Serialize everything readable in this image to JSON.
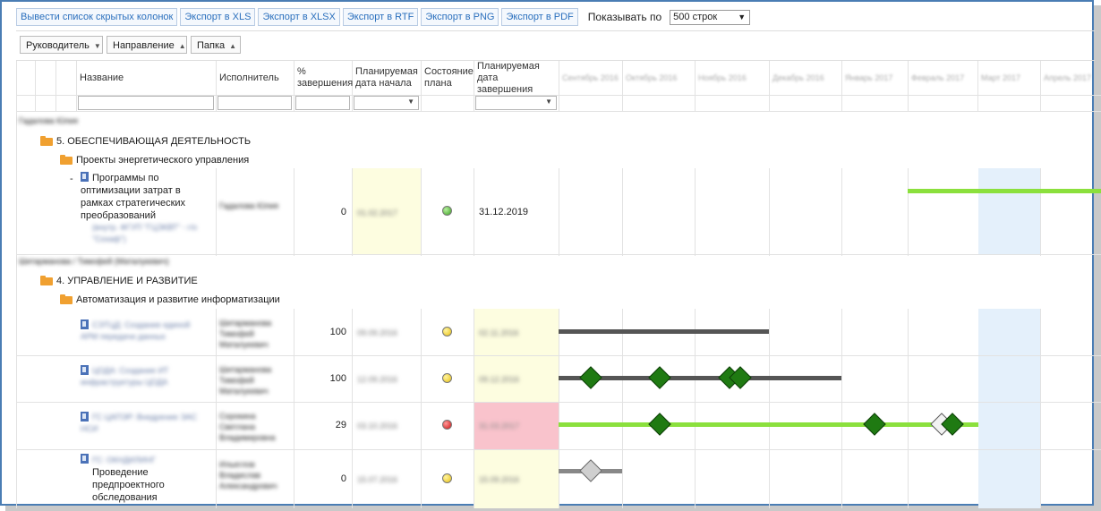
{
  "toolbar": {
    "buttons": [
      "Вывести список скрытых колонок",
      "Экспорт в XLS",
      "Экспорт в XLSX",
      "Экспорт в RTF",
      "Экспорт в PNG",
      "Экспорт в PDF"
    ],
    "show_label": "Показывать по",
    "page_size": "500 строк"
  },
  "grouping": [
    {
      "label": "Руководитель",
      "indicator": "▼"
    },
    {
      "label": "Направление",
      "indicator": "▲"
    },
    {
      "label": "Папка",
      "indicator": "▲"
    }
  ],
  "columns": {
    "name": "Название",
    "executor": "Исполнитель",
    "percent": "% завершения",
    "planned_start": "Планируемая дата начала",
    "plan_state": "Состояние плана",
    "planned_end": "Планируемая дата завершения",
    "timeline": [
      "Сентябрь 2016",
      "Октябрь 2016",
      "Ноябрь 2016",
      "Декабрь 2016",
      "Январь 2017",
      "Февраль 2017",
      "Март 2017",
      "Апрель 2017"
    ]
  },
  "groups": [
    {
      "manager": "Гадалова Юлия",
      "direction": "5. ОБЕСПЕЧИВАЮЩАЯ ДЕЯТЕЛЬНОСТЬ",
      "folder": "Проекты энергетического управления",
      "tasks": [
        {
          "name": "Программы по оптимизации затрат в рамках стратегических преобразований",
          "name_blurred": "(внутр. ФГУП \"ГЦЭКВТ\" - г/о \"Сохаф\")",
          "executor": "Гадалова Юлия",
          "percent": "0",
          "start": "01.02.2017",
          "state": "green",
          "end": "31.12.2019"
        }
      ]
    },
    {
      "manager": "Шитарманова / Тимофей (Маталукевич)",
      "direction": "4. УПРАВЛЕНИЕ И РАЗВИТИЕ",
      "folder": "Автоматизация и развитие информатизации",
      "tasks": [
        {
          "name_blurred": "СЭТЦД: Создание единой АРМ передачи данных",
          "executor": "Шитарманова Тимофей Маталукевич",
          "percent": "100",
          "start": "09.09.2016",
          "state": "yellow",
          "end": "02.11.2016"
        },
        {
          "name_blurred": "ЦОДА: Создание ИТ инфраструктуры ЦОДА",
          "executor": "Шитарманова Тимофей Маталукевич",
          "percent": "100",
          "start": "12.09.2016",
          "state": "yellow",
          "end": "09.12.2016"
        },
        {
          "name_blurred": "ГС ЦАПЭР: Внедрение ЭАС НСИ",
          "executor": "Сорокина Светлана Владимировна",
          "percent": "29",
          "start": "03.10.2016",
          "state": "red",
          "end": "31.03.2017"
        },
        {
          "name_blurred": "ГС: ОКНДИЛИНГ",
          "name": "Проведение предпроектного обследования",
          "executor": "Ильеглов Владислав Александрович",
          "percent": "0",
          "start": "15.07.2016",
          "state": "yellow",
          "end": "15.09.2016"
        }
      ]
    }
  ]
}
